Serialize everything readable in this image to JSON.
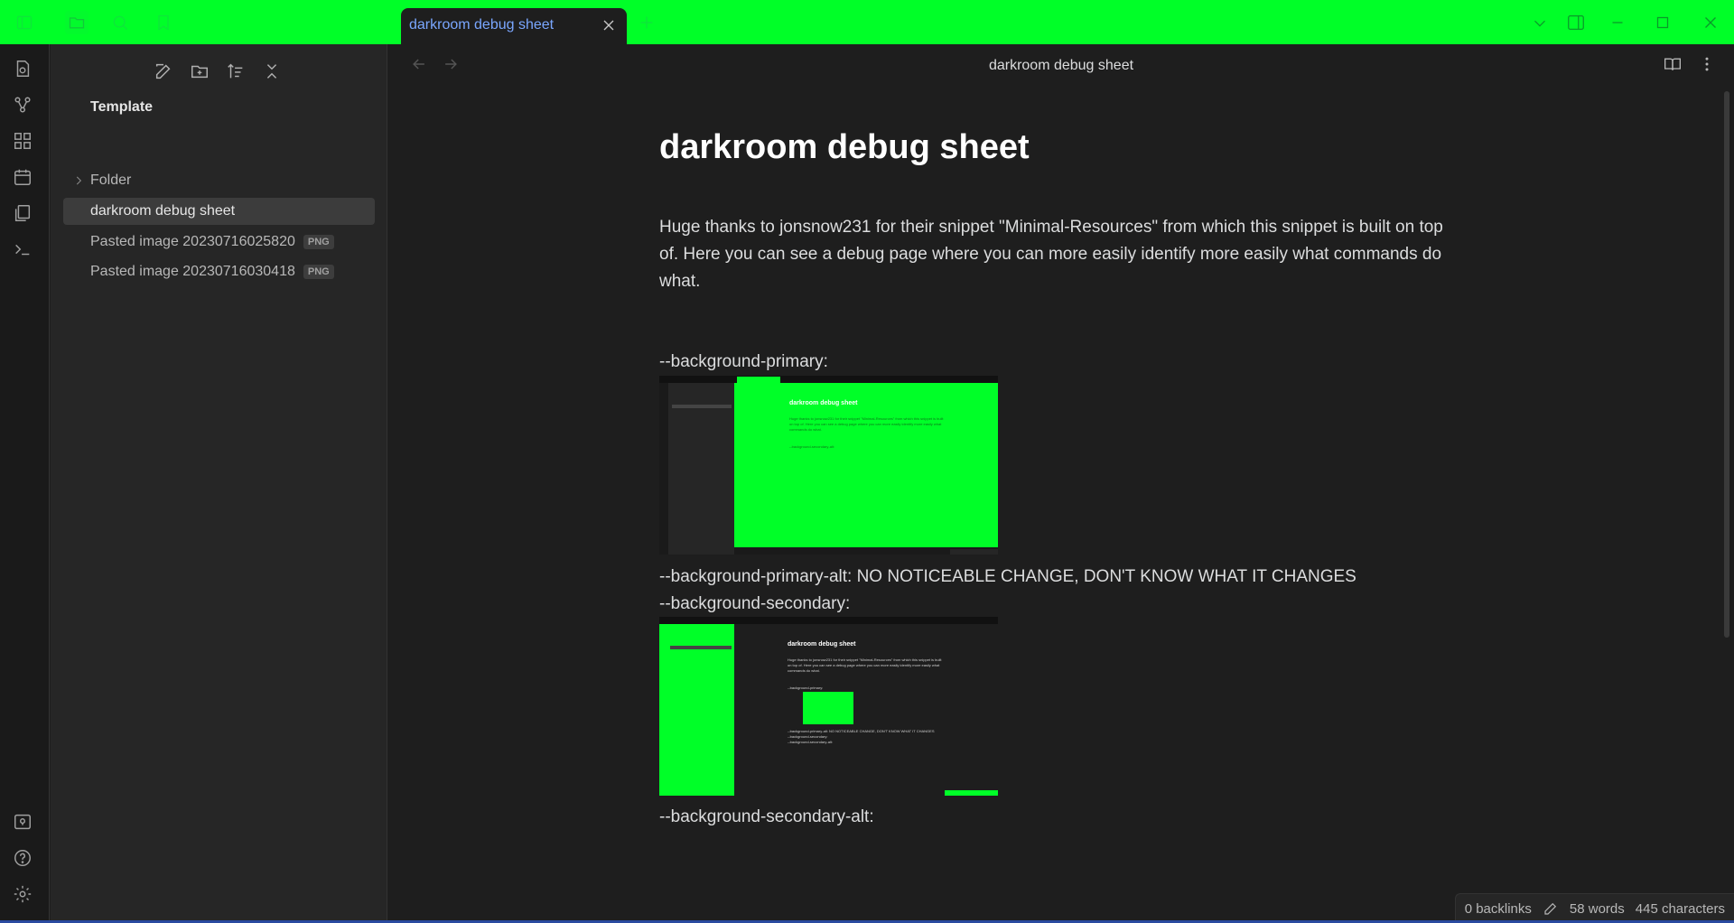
{
  "colors": {
    "accent_bar": "#00ff28",
    "tab_text": "#7aa7ff",
    "background": "#1e1e1e"
  },
  "tab": {
    "label": "darkroom debug sheet"
  },
  "view": {
    "title": "darkroom debug sheet"
  },
  "sidebar": {
    "root": "Template",
    "items": [
      {
        "label": "Folder",
        "type": "folder"
      },
      {
        "label": "darkroom debug sheet",
        "type": "note",
        "active": true
      },
      {
        "label": "Pasted image 20230716025820",
        "badge": "PNG"
      },
      {
        "label": "Pasted image 20230716030418",
        "badge": "PNG"
      }
    ]
  },
  "document": {
    "title": "darkroom debug sheet",
    "paragraph": "Huge thanks to jonsnow231 for their snippet \"Minimal-Resources\" from which this snippet is built on top of. Here you can see a debug page where you can more easily identify more easily what commands do what.",
    "lines": [
      "--background-primary:",
      "--background-primary-alt: NO NOTICEABLE CHANGE, DON'T KNOW WHAT IT CHANGES",
      "--background-secondary:",
      "--background-secondary-alt:"
    ]
  },
  "status": {
    "backlinks": "0 backlinks",
    "words": "58 words",
    "characters": "445 characters"
  }
}
